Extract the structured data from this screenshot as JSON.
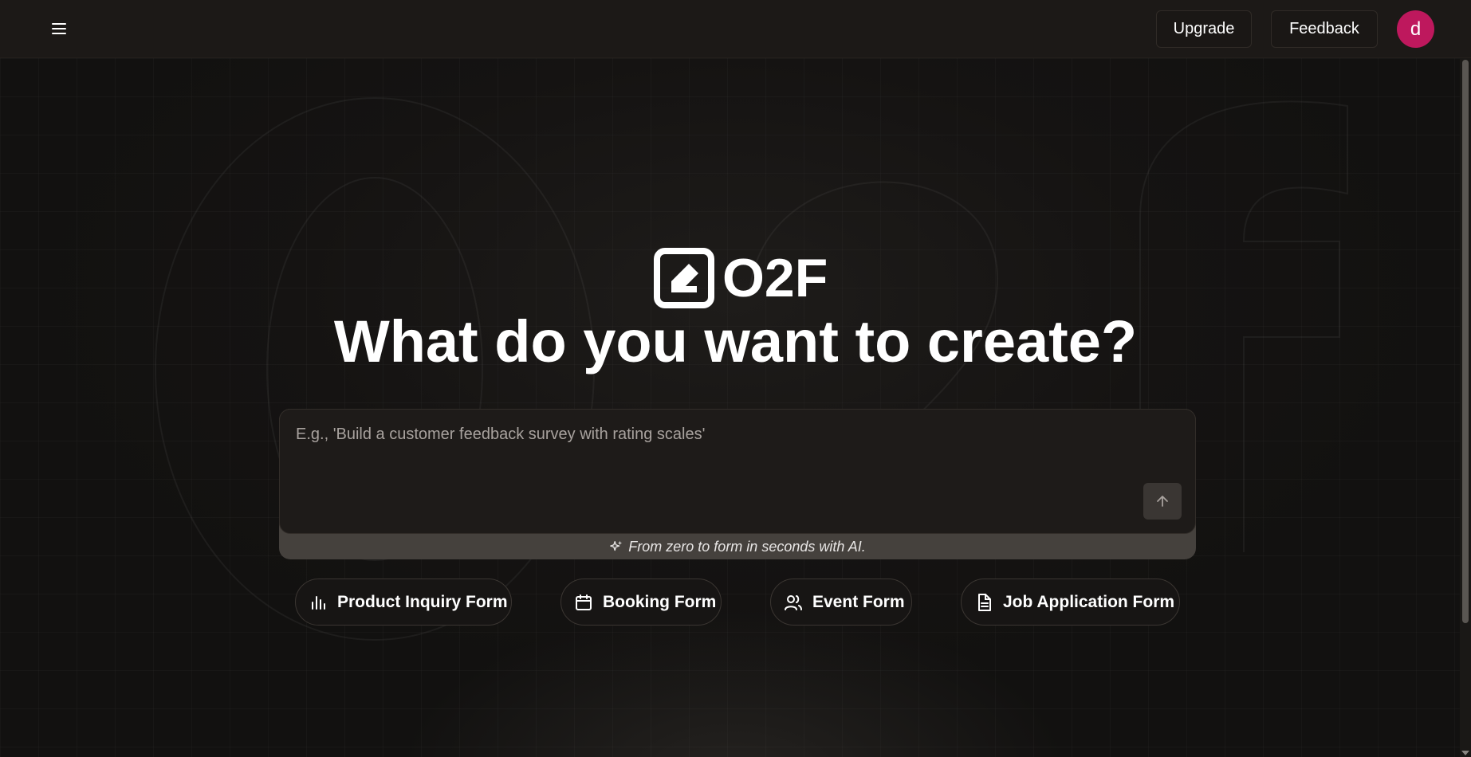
{
  "header": {
    "menu_icon": "hamburger-menu-icon",
    "upgrade_label": "Upgrade",
    "feedback_label": "Feedback",
    "avatar_initial": "d",
    "avatar_color": "#be185d"
  },
  "hero": {
    "brand_name": "O2F",
    "logo_icon": "edit-square-icon",
    "headline": "What do you want to create?"
  },
  "prompt": {
    "placeholder": "E.g., 'Build a customer feedback survey with rating scales'",
    "value": "",
    "send_icon": "arrow-up-icon",
    "tagline": "From zero to form in seconds with AI.",
    "tagline_icon": "sparkles-icon"
  },
  "templates": [
    {
      "label": "Product Inquiry Form",
      "icon": "bar-chart-icon"
    },
    {
      "label": "Booking Form",
      "icon": "calendar-icon"
    },
    {
      "label": "Event Form",
      "icon": "users-icon"
    },
    {
      "label": "Job Application Form",
      "icon": "document-icon"
    }
  ],
  "colors": {
    "background": "#141210",
    "header": "#1c1917",
    "tagline_bar": "#45413d"
  }
}
